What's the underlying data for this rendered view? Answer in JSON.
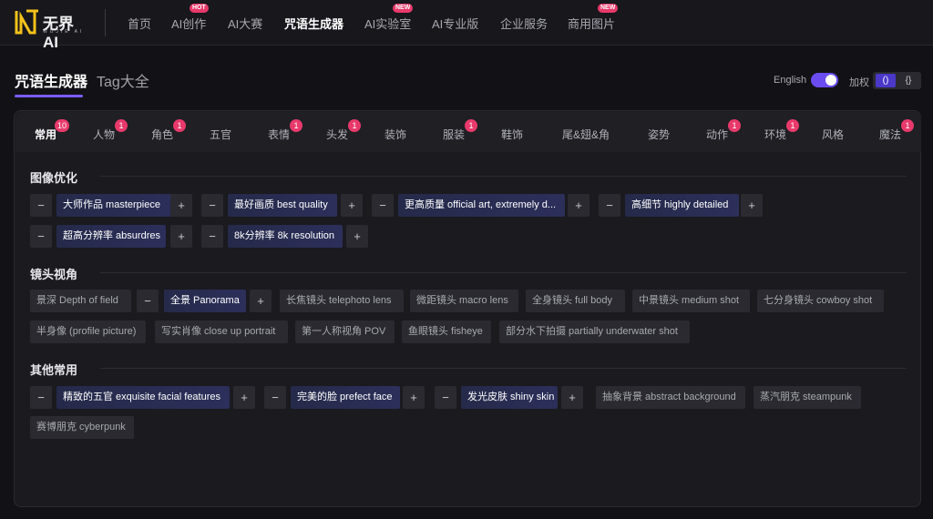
{
  "logo": {
    "text": "无界AI",
    "sub": "WUJIE AI"
  },
  "nav": {
    "items": [
      {
        "label": "首页"
      },
      {
        "label": "AI创作",
        "badge": "HOT"
      },
      {
        "label": "AI大赛"
      },
      {
        "label": "咒语生成器",
        "active": true
      },
      {
        "label": "AI实验室",
        "badge": "NEW"
      },
      {
        "label": "AI专业版"
      },
      {
        "label": "企业服务"
      },
      {
        "label": "商用图片",
        "badge": "NEW"
      }
    ]
  },
  "header": {
    "tabs": [
      "咒语生成器",
      "Tag大全"
    ],
    "lang_label": "English",
    "weight_label": "加权",
    "weight_options": [
      "()",
      "{}"
    ]
  },
  "categories": [
    {
      "label": "常用",
      "badge": "10"
    },
    {
      "label": "人物",
      "badge": "1"
    },
    {
      "label": "角色",
      "badge": "1"
    },
    {
      "label": "五官"
    },
    {
      "label": "表情",
      "badge": "1"
    },
    {
      "label": "头发",
      "badge": "1"
    },
    {
      "label": "装饰"
    },
    {
      "label": "服装",
      "badge": "1"
    },
    {
      "label": "鞋饰"
    },
    {
      "label": "尾&翅&角"
    },
    {
      "label": "姿势"
    },
    {
      "label": "动作",
      "badge": "1"
    },
    {
      "label": "环境",
      "badge": "1"
    },
    {
      "label": "风格"
    },
    {
      "label": "魔法",
      "badge": "1"
    }
  ],
  "sections": [
    {
      "title": "图像优化",
      "tags": [
        {
          "text": "大师作品 masterpiece",
          "on": true
        },
        {
          "text": "最好画质 best quality",
          "on": true
        },
        {
          "text": "更高质量 official art, extremely d...",
          "on": true
        },
        {
          "text": "高细节 highly detailed",
          "on": true
        },
        {
          "text": "超高分辨率 absurdres",
          "on": true
        },
        {
          "text": "8k分辨率 8k resolution",
          "on": true
        }
      ]
    },
    {
      "title": "镜头视角",
      "tags": [
        {
          "text": "景深 Depth of field",
          "on": false
        },
        {
          "text": "全景 Panorama",
          "on": true
        },
        {
          "text": "长焦镜头 telephoto lens",
          "on": false
        },
        {
          "text": "微距镜头 macro lens",
          "on": false
        },
        {
          "text": "全身镜头 full body",
          "on": false
        },
        {
          "text": "中景镜头 medium shot",
          "on": false
        },
        {
          "text": "七分身镜头 cowboy shot",
          "on": false
        },
        {
          "text": "半身像 (profile picture)",
          "on": false
        },
        {
          "text": "写实肖像 close up portrait",
          "on": false
        },
        {
          "text": "第一人称视角 POV",
          "on": false
        },
        {
          "text": "鱼眼镜头 fisheye",
          "on": false
        },
        {
          "text": "部分水下拍摄 partially underwater shot",
          "on": false
        }
      ]
    },
    {
      "title": "其他常用",
      "tags": [
        {
          "text": "精致的五官 exquisite facial features",
          "on": true
        },
        {
          "text": "完美的脸 prefect face",
          "on": true
        },
        {
          "text": "发光皮肤 shiny skin",
          "on": true
        },
        {
          "text": "抽象背景 abstract background",
          "on": false
        },
        {
          "text": "蒸汽朋克 steampunk",
          "on": false
        },
        {
          "text": "赛博朋克 cyberpunk",
          "on": false
        }
      ]
    }
  ],
  "controls": {
    "minus": "−",
    "plus": "+"
  },
  "colors": {
    "accent": "#7a5cff",
    "badge": "#e8396b",
    "active_tag": "#2c2f5a"
  }
}
